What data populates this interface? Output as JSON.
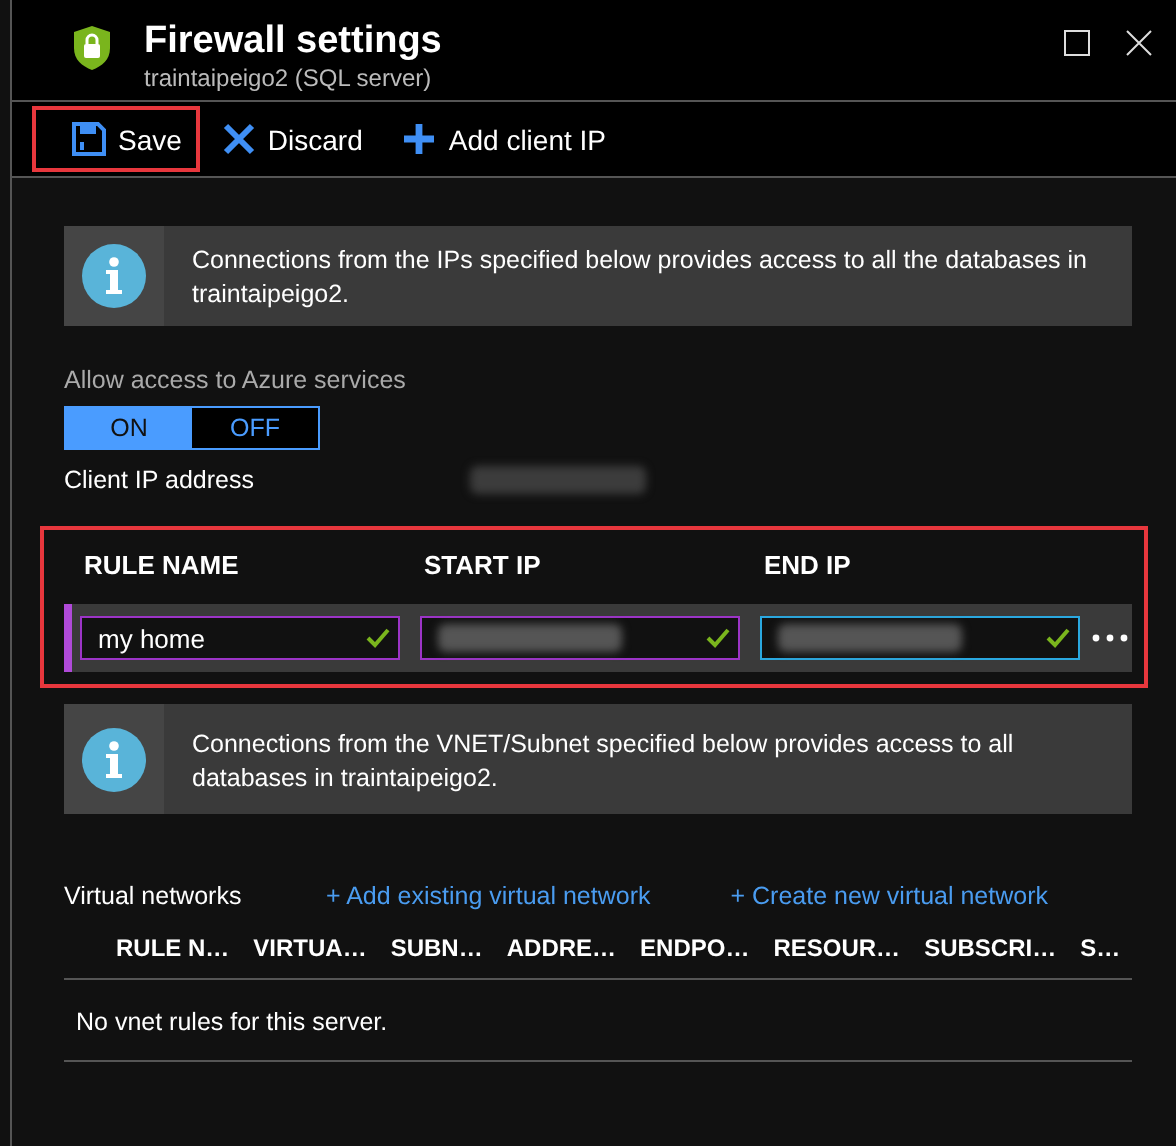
{
  "window": {
    "title": "Firewall settings",
    "subtitle": "traintaipeigo2 (SQL server)"
  },
  "toolbar": [
    {
      "label": "Save",
      "kind": "save",
      "highlighted": true
    },
    {
      "label": "Discard",
      "kind": "discard",
      "highlighted": false
    },
    {
      "label": "Add client IP",
      "kind": "add",
      "highlighted": false
    }
  ],
  "ip_info": {
    "text": "Connections from the IPs specified below provides access to all the databases in traintaipeigo2."
  },
  "azure_access": {
    "label": "Allow access to Azure services",
    "options": [
      {
        "label": "ON",
        "selected": true
      },
      {
        "label": "OFF",
        "selected": false
      }
    ]
  },
  "client_ip": {
    "label": "Client IP address"
  },
  "rules": {
    "highlighted": true,
    "columns": [
      "RULE NAME",
      "START IP",
      "END IP"
    ],
    "rows": [
      {
        "selected": true,
        "cells": [
          {
            "kind": "text",
            "value": "my home",
            "valid": true,
            "focused": false
          },
          {
            "kind": "masked",
            "valid": true,
            "focused": false
          },
          {
            "kind": "masked",
            "valid": true,
            "focused": true
          }
        ]
      }
    ]
  },
  "vnet_info": {
    "text": "Connections from the VNET/Subnet specified below provides access to all databases in traintaipeigo2."
  },
  "virtual_networks": {
    "label": "Virtual networks",
    "actions": [
      "+ Add existing virtual network",
      "+ Create new virtual network"
    ],
    "columns": [
      "RULE N…",
      "VIRTUA…",
      "SUBN…",
      "ADDRE…",
      "ENDPO…",
      "RESOUR…",
      "SUBSCRI…",
      "S…"
    ],
    "empty_text": "No vnet rules for this server."
  }
}
